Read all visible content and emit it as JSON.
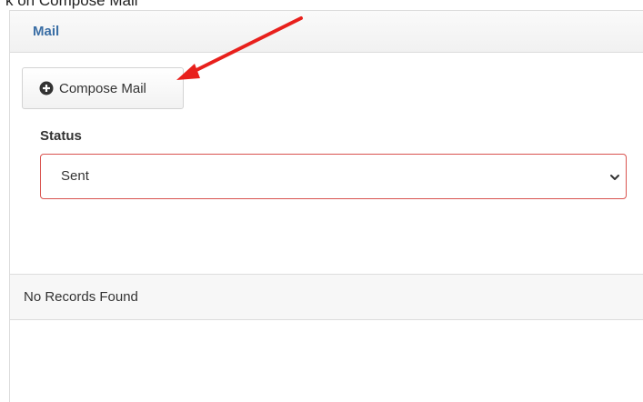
{
  "top_cut_text": "k on Compose Mail",
  "panel": {
    "title": "Mail"
  },
  "compose_button": {
    "label": "Compose Mail",
    "icon": "plus-circle-icon"
  },
  "status": {
    "label": "Status",
    "selected": "Sent"
  },
  "records": {
    "empty_text": "No Records Found"
  },
  "colors": {
    "title_blue": "#3a6ea5",
    "select_border_error": "#d9534f",
    "annotation_arrow": "#e8201c"
  }
}
